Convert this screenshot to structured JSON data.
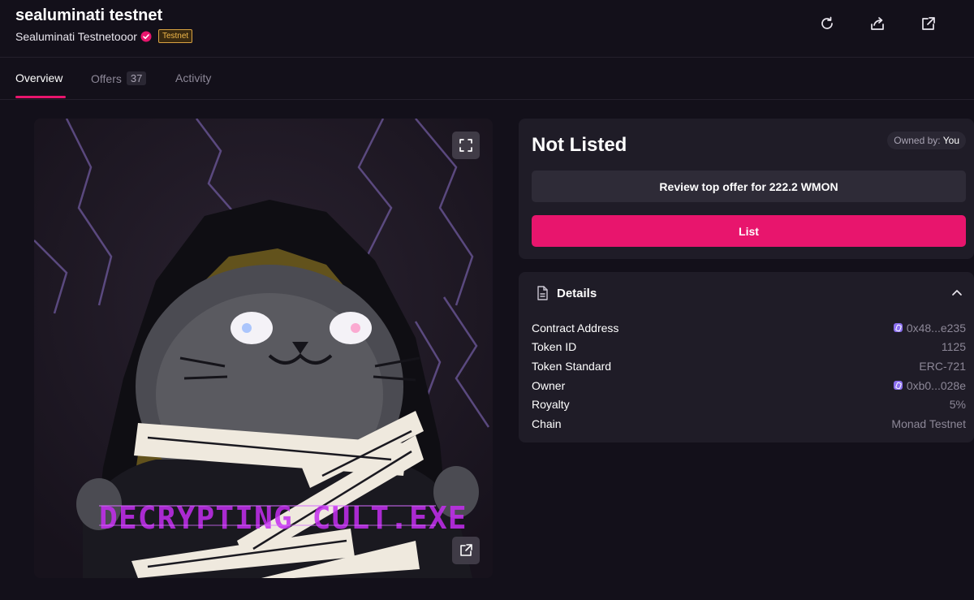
{
  "header": {
    "title": "sealuminati testnet",
    "creator": "Sealuminati Testnetooor",
    "badge": "Testnet",
    "icons": [
      "refresh-icon",
      "share-icon",
      "external-link-icon"
    ]
  },
  "tabs": [
    {
      "label": "Overview",
      "active": true
    },
    {
      "label": "Offers",
      "count": "37"
    },
    {
      "label": "Activity"
    }
  ],
  "artwork": {
    "caption": "DECRYPTING CULT.EXE",
    "icons": [
      "expand-icon",
      "open-external-icon"
    ]
  },
  "listing": {
    "status": "Not Listed",
    "owned_label": "Owned by:",
    "owned_value": "You",
    "review_button": "Review top offer for 222.2 WMON",
    "list_button": "List"
  },
  "details": {
    "title": "Details",
    "rows": [
      {
        "key": "Contract Address",
        "value": "0x48...e235",
        "chain_icon": true
      },
      {
        "key": "Token ID",
        "value": "1125"
      },
      {
        "key": "Token Standard",
        "value": "ERC-721"
      },
      {
        "key": "Owner",
        "value": "0xb0...028e",
        "chain_icon": true
      },
      {
        "key": "Royalty",
        "value": "5%"
      },
      {
        "key": "Chain",
        "value": "Monad Testnet"
      }
    ]
  },
  "colors": {
    "background": "#13101a",
    "card": "#1f1c27",
    "accent": "#e8156d",
    "badge": "#f1b84a"
  }
}
